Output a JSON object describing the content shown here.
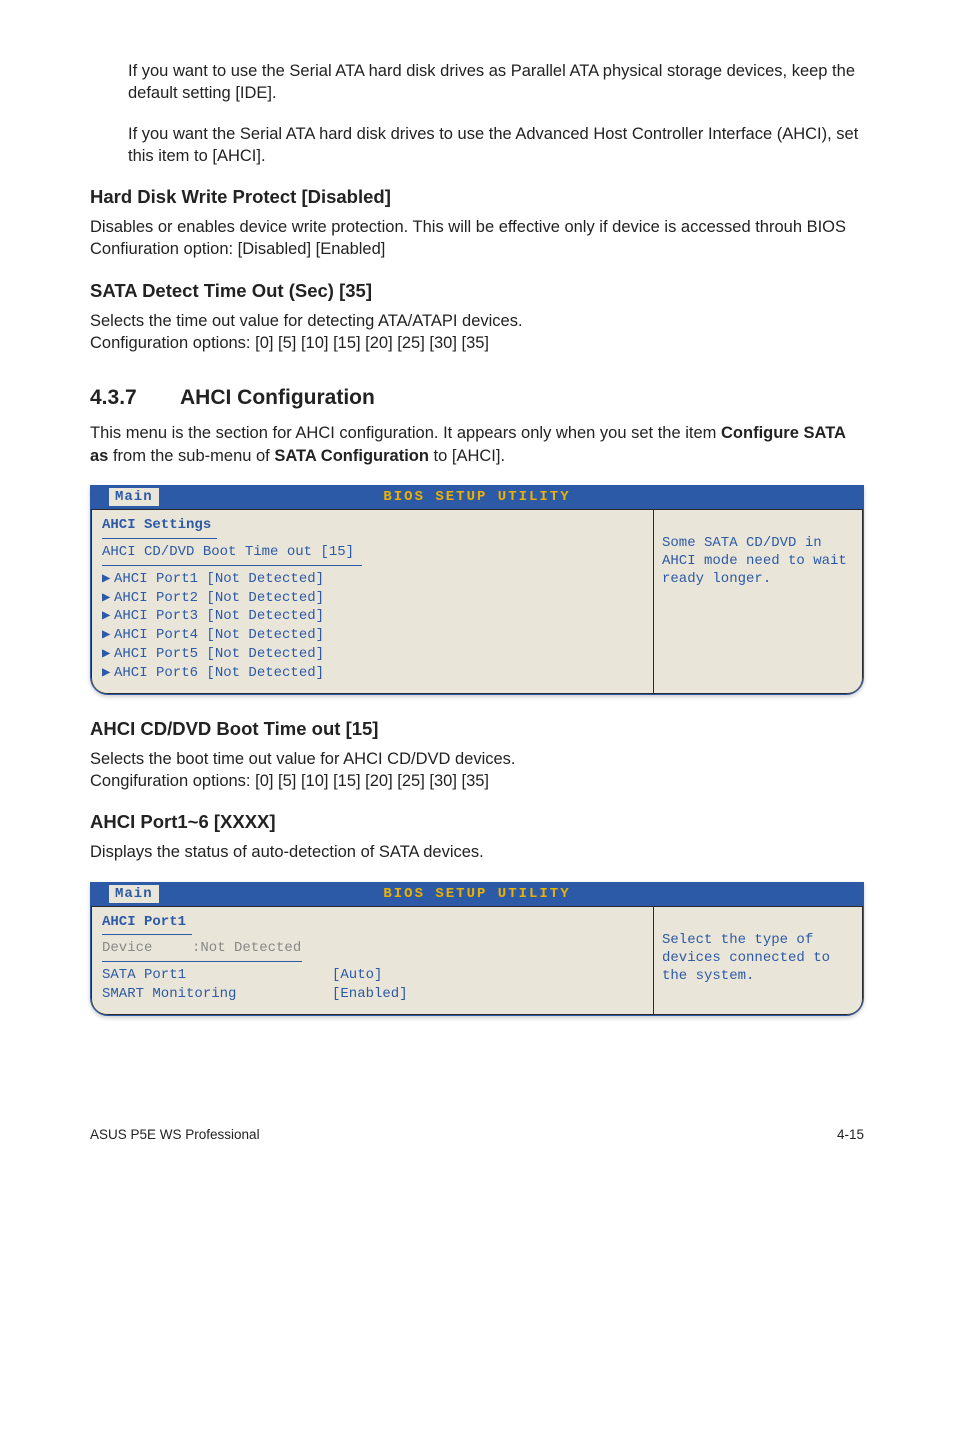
{
  "intro": {
    "p1": "If you want to use the Serial ATA hard disk drives as Parallel ATA physical storage devices, keep the default setting [IDE].",
    "p2": "If you want the Serial ATA hard disk drives to use the Advanced Host Controller Interface (AHCI), set this item to [AHCI]."
  },
  "hd_protect": {
    "title": "Hard Disk Write Protect [Disabled]",
    "body": "Disables or enables device write protection. This will be effective only if device is accessed throuh BIOS Confiuration option: [Disabled] [Enabled]"
  },
  "sata_timeout": {
    "title": "SATA Detect Time Out (Sec) [35]",
    "l1": "Selects the time out value for detecting ATA/ATAPI devices.",
    "l2": "Configuration options: [0] [5] [10] [15] [20] [25] [30] [35]"
  },
  "section": {
    "num": "4.3.7",
    "title": "AHCI Configuration",
    "desc_pre": "This menu is the section for AHCI configuration. It appears only when you set the item ",
    "desc_b1": "Configure SATA as",
    "desc_mid": " from the sub-menu of ",
    "desc_b2": "SATA Configuration",
    "desc_post": " to [AHCI]."
  },
  "bios1": {
    "top": "BIOS SETUP UTILITY",
    "tab": "Main",
    "heading": "AHCI Settings",
    "boot": "AHCI CD/DVD Boot Time out [15]",
    "rows": [
      "AHCI Port1 [Not Detected]",
      "AHCI Port2 [Not Detected]",
      "AHCI Port3 [Not Detected]",
      "AHCI Port4 [Not Detected]",
      "AHCI Port5 [Not Detected]",
      "AHCI Port6 [Not Detected]"
    ],
    "help": "Some SATA CD/DVD in AHCI mode need to wait ready longer."
  },
  "ahci_boot": {
    "title": "AHCI CD/DVD Boot Time out [15]",
    "l1": "Selects the boot time out value for AHCI CD/DVD devices.",
    "l2": "Congifuration options: [0] [5] [10] [15] [20] [25] [30] [35]"
  },
  "ahci_port": {
    "title": "AHCI Port1~6 [XXXX]",
    "body": "Displays the status of auto-detection of SATA devices."
  },
  "bios2": {
    "top": "BIOS SETUP UTILITY",
    "tab": "Main",
    "heading": "AHCI Port1",
    "dev_label": "Device",
    "dev_val": ":Not Detected",
    "r1k": "SATA Port1",
    "r1v": "[Auto]",
    "r2k": "SMART Monitoring",
    "r2v": "[Enabled]",
    "help": "Select the type of devices connected to the system."
  },
  "footer": {
    "left": "ASUS P5E WS Professional",
    "right": "4-15"
  }
}
